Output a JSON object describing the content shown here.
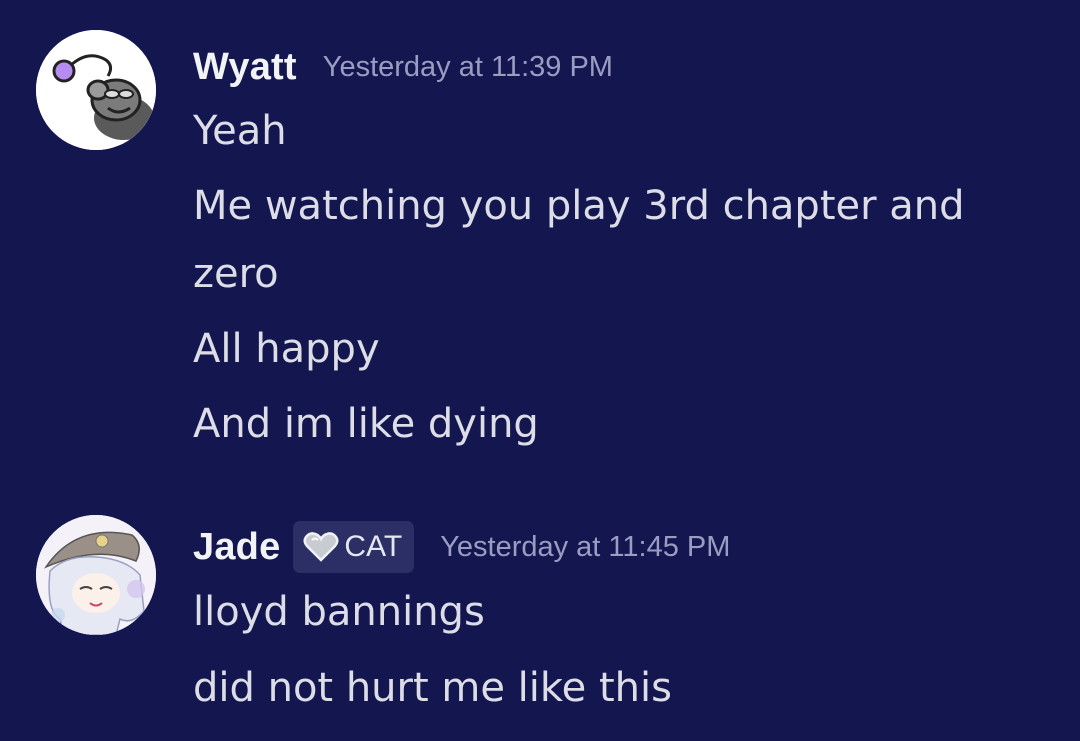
{
  "messages": [
    {
      "author": "Wyatt",
      "timestamp": "Yesterday at 11:39 PM",
      "avatar_icon": "rat-meme-avatar",
      "lines": [
        "Yeah",
        "Me watching you play 3rd chapter and",
        "zero",
        "All happy",
        "And im like dying"
      ]
    },
    {
      "author": "Jade",
      "tag": {
        "icon": "heart-icon",
        "label": "CAT"
      },
      "timestamp": "Yesterday at 11:45 PM",
      "avatar_icon": "anime-character-avatar",
      "lines": [
        "lloyd bannings",
        "did not hurt me like this"
      ]
    }
  ],
  "colors": {
    "background": "#141650",
    "username": "#f2f3f5",
    "timestamp": "#9a9cc2",
    "message_text": "#dcdde6",
    "tag_background": "#2c2f66"
  }
}
